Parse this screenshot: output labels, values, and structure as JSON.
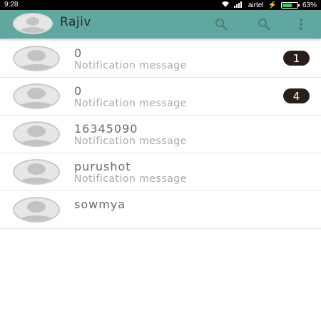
{
  "status_bar": {
    "time": "9:28",
    "carrier": "airtel",
    "battery_percent": "63%",
    "battery_level": 0.63,
    "battery_color": "#2fd35a"
  },
  "toolbar": {
    "title": "Rajiv",
    "background": "#60a79f",
    "icons": [
      "search-icon",
      "search-icon",
      "overflow-menu-icon"
    ]
  },
  "conversations": [
    {
      "name": "0",
      "message": "Notification message",
      "badge": "1"
    },
    {
      "name": "0",
      "message": "Notification message",
      "badge": "4"
    },
    {
      "name": "16345090",
      "message": "Notification message",
      "badge": ""
    },
    {
      "name": "purushot",
      "message": "Notification message",
      "badge": ""
    },
    {
      "name": "sowmya",
      "message": "",
      "badge": ""
    }
  ]
}
